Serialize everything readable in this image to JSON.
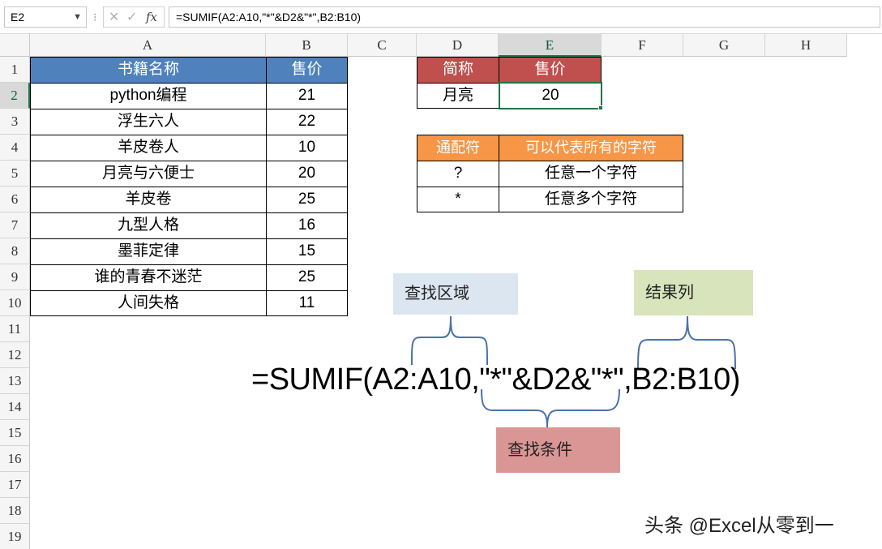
{
  "formula_bar": {
    "name_box": "E2",
    "formula": "=SUMIF(A2:A10,\"*\"&D2&\"*\",B2:B10)",
    "fx_label": "fx"
  },
  "columns": [
    "A",
    "B",
    "C",
    "D",
    "E",
    "F",
    "G",
    "H"
  ],
  "rows": [
    "1",
    "2",
    "3",
    "4",
    "5",
    "6",
    "7",
    "8",
    "9",
    "10",
    "11",
    "12",
    "13",
    "14",
    "15",
    "16",
    "17",
    "18",
    "19"
  ],
  "books_table": {
    "headers": [
      "书籍名称",
      "售价"
    ],
    "rows": [
      [
        "python编程",
        "21"
      ],
      [
        "浮生六人",
        "22"
      ],
      [
        "羊皮卷人",
        "10"
      ],
      [
        "月亮与六便士",
        "20"
      ],
      [
        "羊皮卷",
        "25"
      ],
      [
        "九型人格",
        "16"
      ],
      [
        "墨菲定律",
        "15"
      ],
      [
        "谁的青春不迷茫",
        "25"
      ],
      [
        "人间失格",
        "11"
      ]
    ]
  },
  "lookup_table": {
    "headers": [
      "简称",
      "售价"
    ],
    "row": [
      "月亮",
      "20"
    ]
  },
  "wildcard_table": {
    "headers": [
      "通配符",
      "可以代表所有的字符"
    ],
    "rows": [
      [
        "?",
        "任意一个字符"
      ],
      [
        "*",
        "任意多个字符"
      ]
    ]
  },
  "annotations": {
    "range_label": "查找区域",
    "result_label": "结果列",
    "criteria_label": "查找条件",
    "big_formula": "=SUMIF(A2:A10,\"*\"&D2&\"*\",B2:B10)"
  },
  "watermark": "头条 @Excel从零到一",
  "colors": {
    "books_header": "#4f81bd",
    "lookup_header": "#c0504d",
    "wildcard_header": "#f79646",
    "range_box": "#dce6f1",
    "result_box": "#d8e4bc",
    "criteria_box": "#da9694",
    "selection": "#217346"
  }
}
